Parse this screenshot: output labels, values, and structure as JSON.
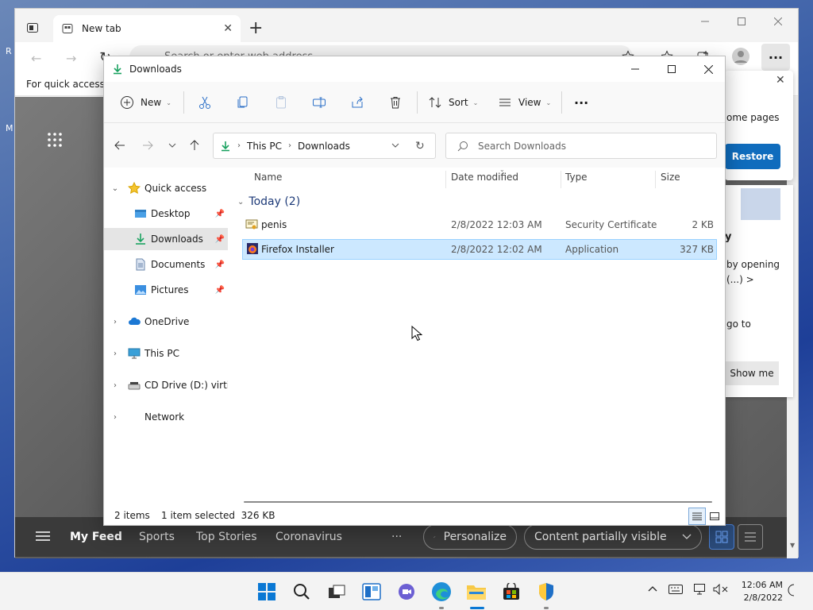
{
  "desktop": {
    "frag1": "R",
    "frag2": "M"
  },
  "browser": {
    "tab_title": "New tab",
    "address_placeholder": "Search or enter web address",
    "favbar_text": "For quick access, p",
    "popup": {
      "text": "ome pages",
      "button": "Restore"
    },
    "card": {
      "line1": "y",
      "line2": "by opening",
      "line3": "(...) >",
      "line4": "go to",
      "button": "Show me"
    },
    "feed": {
      "items": [
        "My Feed",
        "Sports",
        "Top Stories",
        "Coronavirus"
      ],
      "more": "···",
      "personalize": "Personalize",
      "content_visibility": "Content partially visible"
    }
  },
  "explorer": {
    "title": "Downloads",
    "commands": {
      "new": "New",
      "sort": "Sort",
      "view": "View",
      "more": "···"
    },
    "address": {
      "seg1": "This PC",
      "seg2": "Downloads"
    },
    "search_placeholder": "Search Downloads",
    "sidebar": [
      {
        "label": "Quick access"
      },
      {
        "label": "Desktop"
      },
      {
        "label": "Downloads"
      },
      {
        "label": "Documents"
      },
      {
        "label": "Pictures"
      },
      {
        "label": "OneDrive"
      },
      {
        "label": "This PC"
      },
      {
        "label": "CD Drive (D:) virtio-win"
      },
      {
        "label": "Network"
      }
    ],
    "columns": {
      "name": "Name",
      "date": "Date modified",
      "type": "Type",
      "size": "Size"
    },
    "group": "Today (2)",
    "files": [
      {
        "name": "penis",
        "date": "2/8/2022 12:03 AM",
        "type": "Security Certificate",
        "size": "2 KB"
      },
      {
        "name": "Firefox Installer",
        "date": "2/8/2022 12:02 AM",
        "type": "Application",
        "size": "327 KB"
      }
    ],
    "status": {
      "items": "2 items",
      "selected": "1 item selected  326 KB"
    }
  },
  "taskbar": {
    "time": "12:06 AM",
    "date": "2/8/2022"
  }
}
